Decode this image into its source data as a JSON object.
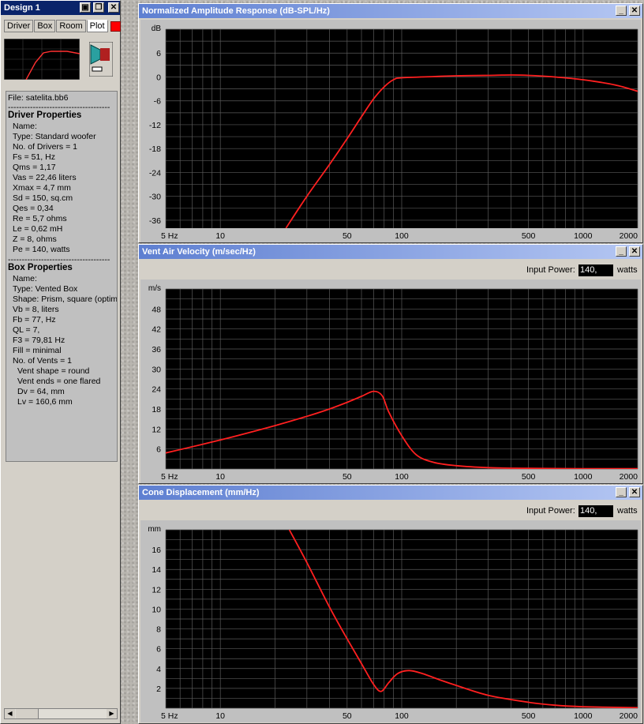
{
  "design_window": {
    "title": "Design 1",
    "tabs": [
      "Driver",
      "Box",
      "Room",
      "Plot"
    ],
    "file": "File: satelita.bb6",
    "driver_heading": "Driver Properties",
    "driver_lines": [
      "Name:",
      "Type: Standard woofer",
      "No. of Drivers = 1",
      "Fs = 51, Hz",
      "Qms = 1,17",
      "Vas = 22,46 liters",
      "Xmax = 4,7 mm",
      "Sd = 150, sq.cm",
      "Qes = 0,34",
      "Re = 5,7 ohms",
      "Le = 0,62 mH",
      "Z = 8, ohms",
      "Pe = 140, watts"
    ],
    "box_heading": "Box Properties",
    "box_lines": [
      "Name:",
      "Type: Vented Box",
      "Shape: Prism, square (optimum)",
      "Vb = 8, liters",
      "Fb = 77, Hz",
      "QL = 7,",
      "F3 = 79,81 Hz",
      "Fill = minimal",
      "No. of Vents = 1"
    ],
    "vent_lines": [
      "Vent shape = round",
      "Vent ends = one flared",
      "Dv = 64, mm",
      "Lv = 160,6 mm"
    ],
    "separator": "-------------------------------------",
    "accent_color": "#ff0000"
  },
  "plots": {
    "amplitude": {
      "title": "Normalized Amplitude Response (dB-SPL/Hz)",
      "unit": "dB",
      "chart_data": {
        "type": "line",
        "title": "Normalized Amplitude Response (dB-SPL/Hz)",
        "ylabel": "dB",
        "ylim": [
          -38,
          12
        ],
        "y_ticks": [
          6,
          0,
          -6,
          -12,
          -18,
          -24,
          -30,
          -36
        ],
        "x_scale": "log",
        "x_range": [
          5,
          2000
        ],
        "x_tick_labels": [
          "5 Hz",
          "10",
          "50",
          "100",
          "500",
          "1000",
          "2000"
        ],
        "x_tick_values": [
          5,
          10,
          50,
          100,
          500,
          1000,
          2000
        ],
        "grid": true,
        "line_color": "#ff2020",
        "x": [
          23,
          30,
          40,
          50,
          60,
          70,
          80,
          90,
          100,
          150,
          200,
          300,
          400,
          500,
          700,
          1000,
          1500,
          2000
        ],
        "y": [
          -38,
          -30,
          -22,
          -15.5,
          -10,
          -5.5,
          -2.5,
          -0.7,
          -0.2,
          0.1,
          0.3,
          0.4,
          0.5,
          0.4,
          0,
          -0.7,
          -2,
          -3.6
        ]
      }
    },
    "velocity": {
      "title": "Vent Air Velocity (m/sec/Hz)",
      "unit": "m/s",
      "input_power_label": "Input Power:",
      "input_power_value": "140,",
      "input_power_unit": "watts",
      "chart_data": {
        "type": "line",
        "title": "Vent Air Velocity (m/sec/Hz)",
        "ylabel": "m/s",
        "ylim": [
          0,
          54
        ],
        "y_ticks": [
          6,
          12,
          18,
          24,
          30,
          36,
          42,
          48
        ],
        "x_scale": "log",
        "x_range": [
          5,
          2000
        ],
        "x_tick_labels": [
          "5 Hz",
          "10",
          "50",
          "100",
          "500",
          "1000",
          "2000"
        ],
        "x_tick_values": [
          5,
          10,
          50,
          100,
          500,
          1000,
          2000
        ],
        "grid": true,
        "line_color": "#ff2020",
        "x": [
          5,
          10,
          20,
          30,
          40,
          50,
          60,
          70,
          78,
          85,
          100,
          120,
          150,
          200,
          300,
          500,
          1000,
          2000
        ],
        "y": [
          4.8,
          8.7,
          13,
          15.8,
          18,
          20,
          21.8,
          23.3,
          22,
          17,
          10,
          4.3,
          2,
          1,
          0.4,
          0.2,
          0.1,
          0.1
        ]
      }
    },
    "displacement": {
      "title": "Cone Displacement (mm/Hz)",
      "unit": "mm",
      "input_power_label": "Input Power:",
      "input_power_value": "140,",
      "input_power_unit": "watts",
      "chart_data": {
        "type": "line",
        "title": "Cone Displacement (mm/Hz)",
        "ylabel": "mm",
        "ylim": [
          0,
          18
        ],
        "y_ticks": [
          2,
          4,
          6,
          8,
          10,
          12,
          14,
          16
        ],
        "x_scale": "log",
        "x_range": [
          5,
          2000
        ],
        "x_tick_labels": [
          "5 Hz",
          "10",
          "50",
          "100",
          "500",
          "1000",
          "2000"
        ],
        "x_tick_values": [
          5,
          10,
          50,
          100,
          500,
          1000,
          2000
        ],
        "grid": true,
        "line_color": "#ff2020",
        "x": [
          24,
          30,
          40,
          50,
          60,
          70,
          77,
          85,
          95,
          110,
          130,
          160,
          200,
          300,
          500,
          700,
          1000,
          2000
        ],
        "y": [
          18,
          14.7,
          10.2,
          7,
          4.5,
          2.4,
          1.7,
          2.6,
          3.5,
          3.8,
          3.5,
          2.9,
          2.3,
          1.3,
          0.6,
          0.3,
          0.15,
          0.05
        ]
      }
    }
  }
}
